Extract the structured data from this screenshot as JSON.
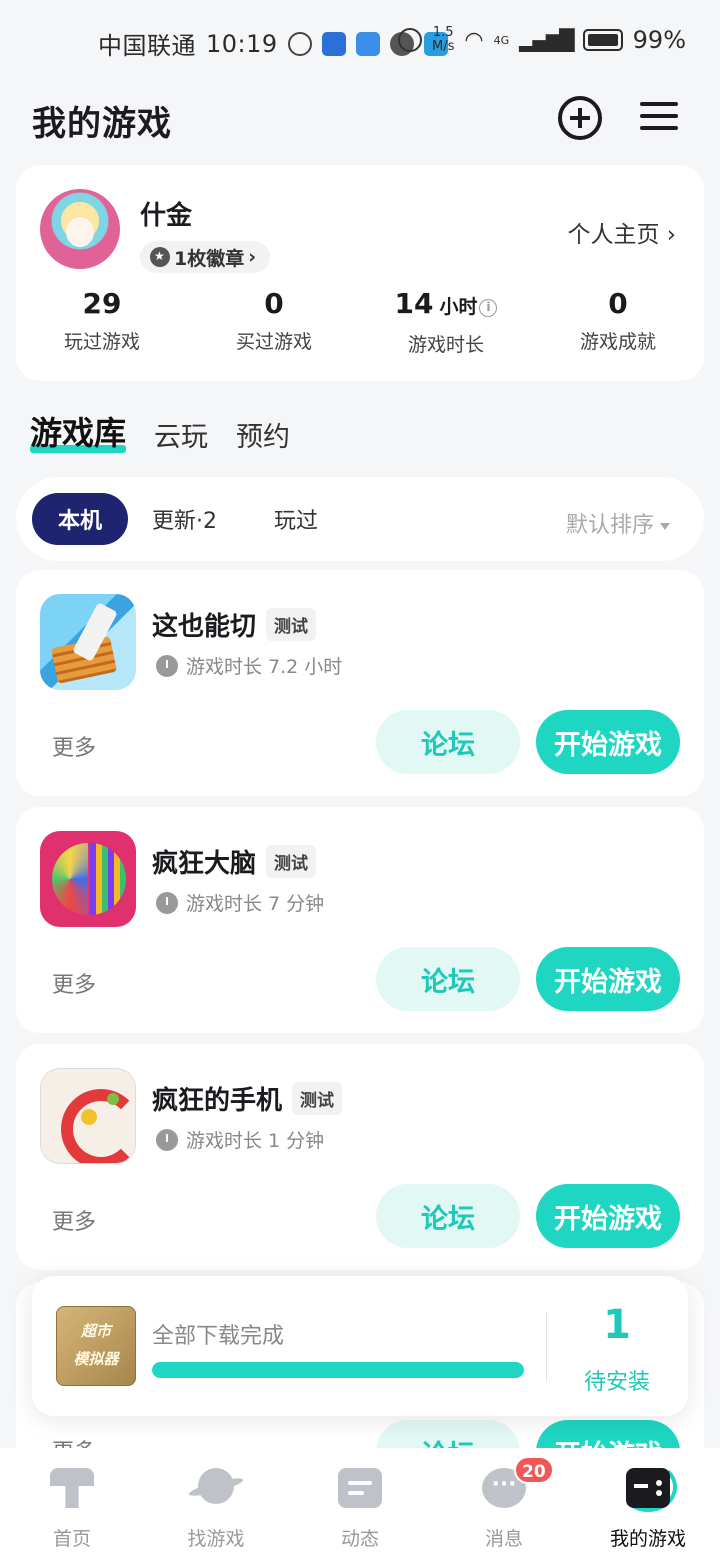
{
  "status_bar": {
    "carrier": "中国联通",
    "time": "10:19",
    "network_speed": "1.5",
    "network_unit": "M/s",
    "network_type": "4G",
    "battery": "99%"
  },
  "header": {
    "title": "我的游戏"
  },
  "profile": {
    "username": "什金",
    "badge_label": "1枚徽章",
    "profile_link": "个人主页",
    "stats": [
      {
        "value": "29",
        "unit": "",
        "label": "玩过游戏"
      },
      {
        "value": "0",
        "unit": "",
        "label": "买过游戏"
      },
      {
        "value": "14",
        "unit": "小时",
        "label": "游戏时长"
      },
      {
        "value": "0",
        "unit": "",
        "label": "游戏成就"
      }
    ]
  },
  "main_tabs": [
    {
      "label": "游戏库",
      "active": true
    },
    {
      "label": "云玩",
      "active": false
    },
    {
      "label": "预约",
      "active": false
    }
  ],
  "filters": {
    "chips": [
      "本机",
      "更新·2",
      "玩过"
    ],
    "sort_label": "默认排序"
  },
  "games": [
    {
      "name": "这也能切",
      "tag": "测试",
      "playtime": "游戏时长 7.2 小时",
      "more": "更多",
      "forum": "论坛",
      "play": "开始游戏",
      "icon": "cut-game-icon"
    },
    {
      "name": "疯狂大脑",
      "tag": "测试",
      "playtime": "游戏时长 7 分钟",
      "more": "更多",
      "forum": "论坛",
      "play": "开始游戏",
      "icon": "brain-game-icon"
    },
    {
      "name": "疯狂的手机",
      "tag": "测试",
      "playtime": "游戏时长 1 分钟",
      "more": "更多",
      "forum": "论坛",
      "play": "开始游戏",
      "icon": "phone-game-icon"
    },
    {
      "name": "",
      "tag": "",
      "playtime": "",
      "more": "更多",
      "forum": "论坛",
      "play": "开始游戏",
      "icon": ""
    }
  ],
  "download": {
    "thumb_text_line1": "超市",
    "thumb_text_line2": "模拟器",
    "status": "全部下载完成",
    "progress": 1.0,
    "count": "1",
    "count_label": "待安装"
  },
  "bottom_nav": [
    {
      "label": "首页",
      "icon": "home-icon",
      "active": false
    },
    {
      "label": "找游戏",
      "icon": "planet-icon",
      "active": false
    },
    {
      "label": "动态",
      "icon": "feed-icon",
      "active": false
    },
    {
      "label": "消息",
      "icon": "message-icon",
      "active": false,
      "badge": "20"
    },
    {
      "label": "我的游戏",
      "icon": "gamepad-icon",
      "active": true
    }
  ],
  "colors": {
    "accent": "#1ed6c2",
    "accent_light": "#e2f8f5",
    "chip_active": "#1f2470",
    "badge_red": "#f25757"
  }
}
